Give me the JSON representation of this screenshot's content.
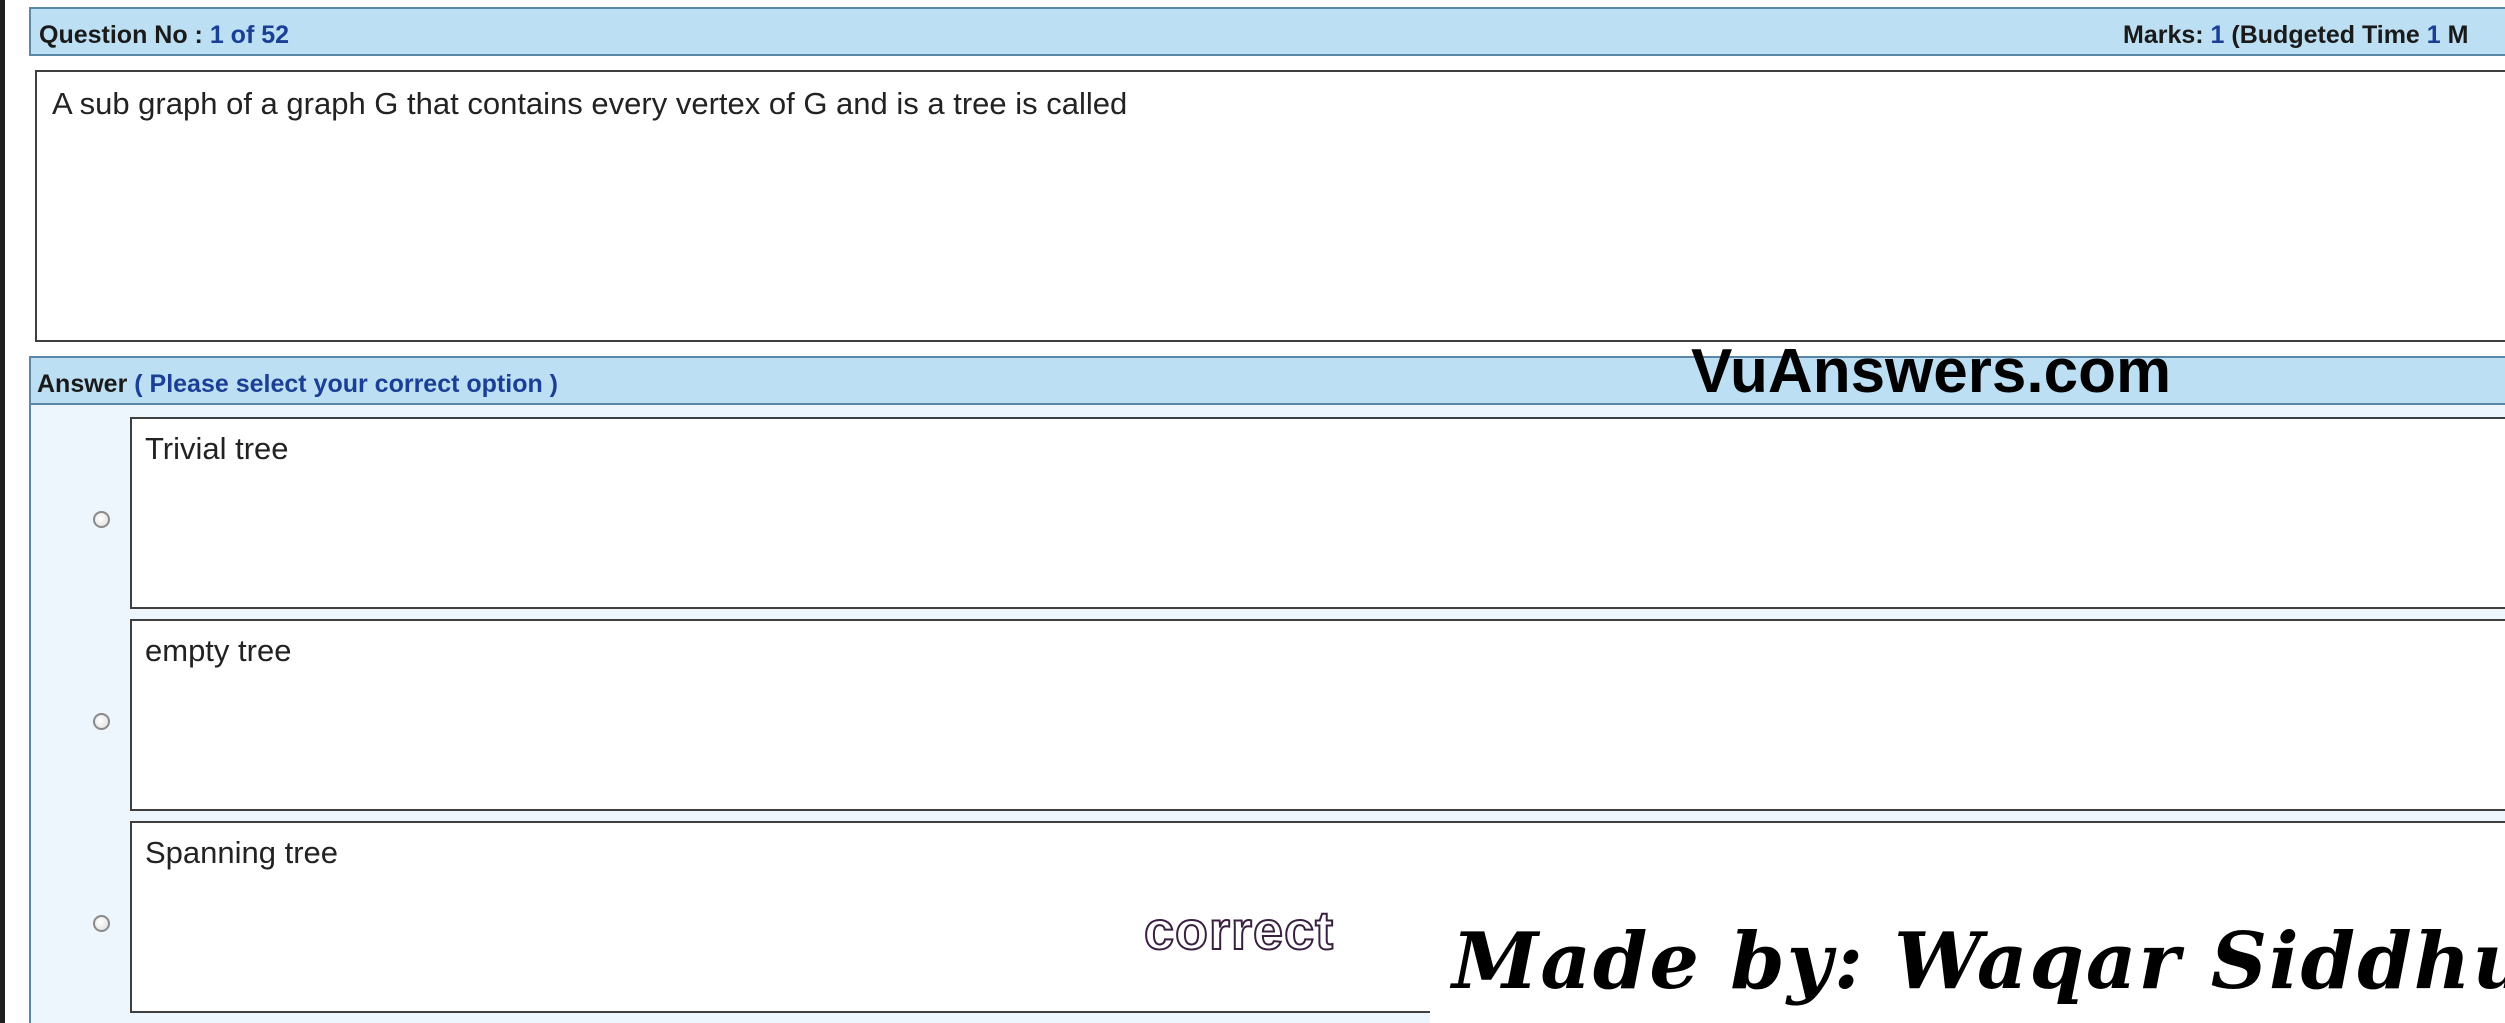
{
  "header": {
    "question_label": "Question No : ",
    "question_number": "1 of 52",
    "marks_label": "Marks: ",
    "marks_value": "1",
    "budget_prefix": " (Budgeted Time ",
    "budget_value": "1",
    "budget_suffix": " M"
  },
  "question": {
    "text": "A sub graph of a graph G that contains every vertex of G and is a tree is called"
  },
  "answer": {
    "label": "Answer",
    "hint": " ( Please select your correct option )"
  },
  "options": [
    {
      "text": "Trivial tree"
    },
    {
      "text": "empty tree"
    },
    {
      "text": "Spanning tree"
    }
  ],
  "overlays": {
    "site_watermark": "VuAnswers.com",
    "correct_mark": "correct",
    "credit": "Made by: Waqar Siddhu"
  },
  "colors": {
    "bar_bg": "#bcdff4",
    "bar_border": "#5a86a8",
    "accent_text": "#1b3f94",
    "answer_area_bg": "#edf6fd"
  }
}
